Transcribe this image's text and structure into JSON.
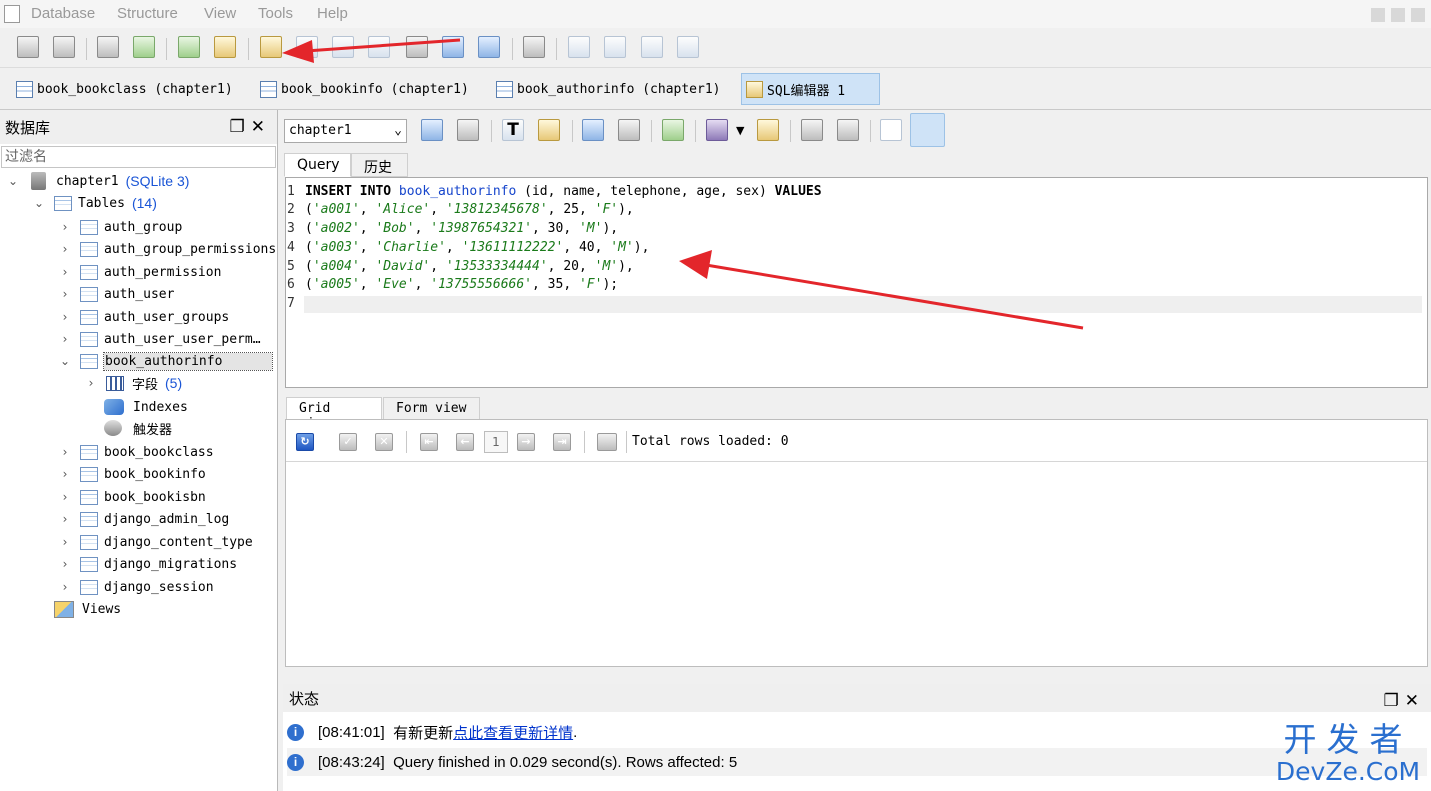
{
  "menu": [
    "Database",
    "Structure",
    "View",
    "Tools",
    "Help"
  ],
  "doc_tabs": [
    {
      "label": "book_bookclass (chapter1)"
    },
    {
      "label": "book_bookinfo (chapter1)"
    },
    {
      "label": "book_authorinfo (chapter1)"
    },
    {
      "label": "SQL编辑器 1",
      "active": true
    }
  ],
  "left_panel": {
    "title": "数据库",
    "filter_placeholder": "过滤名",
    "db": {
      "name": "chapter1",
      "type": "(SQLite 3)"
    },
    "tables_label": "Tables",
    "tables_count": "(14)",
    "tables": [
      "auth_group",
      "auth_group_permissions",
      "auth_permission",
      "auth_user",
      "auth_user_groups",
      "auth_user_user_perm…",
      "book_authorinfo",
      "book_bookclass",
      "book_bookinfo",
      "book_bookisbn",
      "django_admin_log",
      "django_content_type",
      "django_migrations",
      "django_session"
    ],
    "expanded": {
      "fields_label": "字段",
      "fields_count": "(5)",
      "indexes_label": "Indexes",
      "triggers_label": "触发器"
    },
    "views_label": "Views"
  },
  "editor": {
    "database": "chapter1",
    "tabs": [
      "Query",
      "历史"
    ],
    "lines": [
      "1",
      "2",
      "3",
      "4",
      "5",
      "6",
      "7"
    ],
    "sql": {
      "insert": "INSERT INTO",
      "table": "book_authorinfo",
      "columns": " (id, name, telephone, age, sex) ",
      "values_kw": "VALUES",
      "rows": [
        {
          "id": "'a001'",
          "name": "'Alice'",
          "tel": "'13812345678'",
          "age": "25",
          "sex": "'F'",
          "end": "),"
        },
        {
          "id": "'a002'",
          "name": "'Bob'",
          "tel": "'13987654321'",
          "age": "30",
          "sex": "'M'",
          "end": "),"
        },
        {
          "id": "'a003'",
          "name": "'Charlie'",
          "tel": "'13611112222'",
          "age": "40",
          "sex": "'M'",
          "end": "),"
        },
        {
          "id": "'a004'",
          "name": "'David'",
          "tel": "'13533334444'",
          "age": "20",
          "sex": "'M'",
          "end": "),"
        },
        {
          "id": "'a005'",
          "name": "'Eve'",
          "tel": "'13755556666'",
          "age": "35",
          "sex": "'F'",
          "end": ");"
        }
      ]
    }
  },
  "results": {
    "tabs": [
      "Grid view",
      "Form view"
    ],
    "page": "1",
    "rows_loaded": "Total rows loaded: 0"
  },
  "status": {
    "title": "状态",
    "messages": [
      {
        "time": "[08:41:01]",
        "text": "有新更新 ",
        "link": "点此查看更新详情",
        "tail": "."
      },
      {
        "time": "[08:43:24]",
        "text": "Query finished in 0.029 second(s). Rows affected: 5",
        "link": "",
        "tail": ""
      }
    ]
  },
  "watermark": {
    "line1": "开发者",
    "line2": "DevZe.CoM"
  },
  "colors": {
    "arrow": "#e3262b",
    "accent": "#2a6fcf"
  }
}
